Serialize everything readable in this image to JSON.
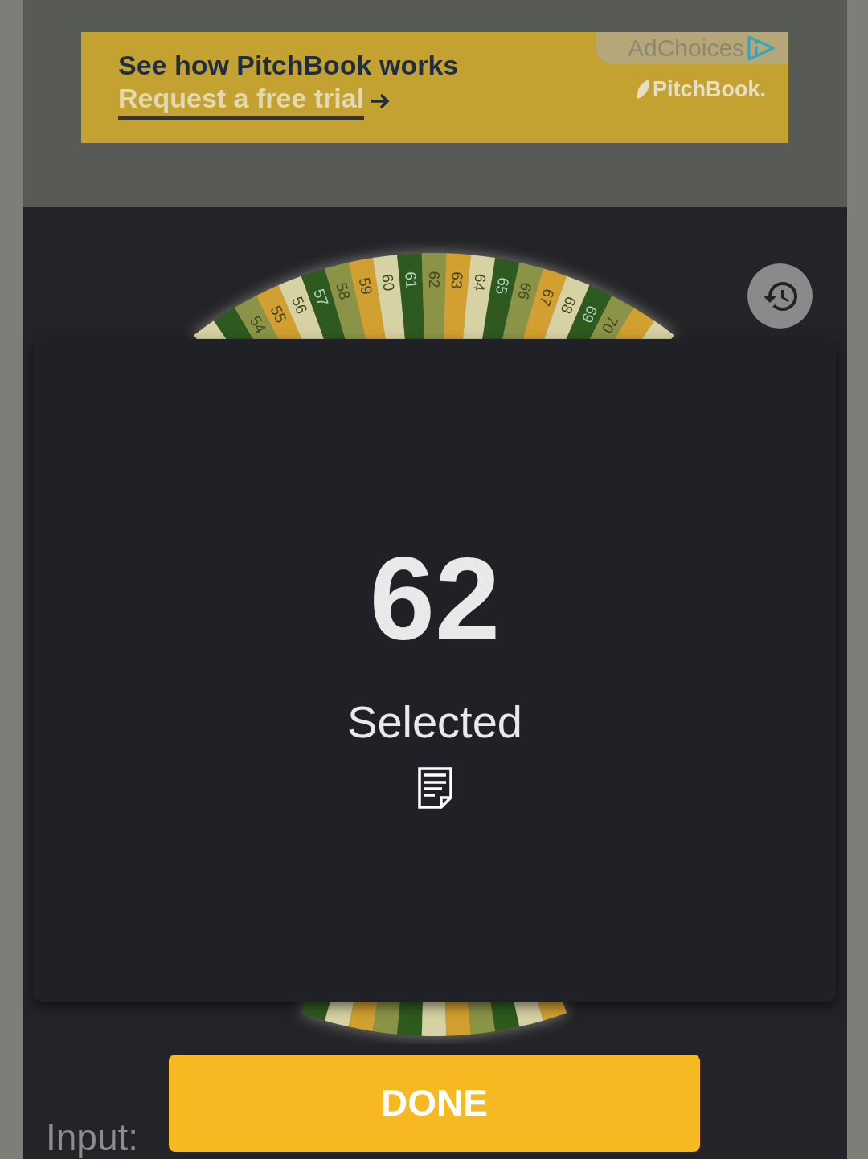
{
  "ad": {
    "headline": "See how PitchBook works",
    "link": "Request a free trial",
    "adchoices": "AdChoices",
    "brand": "PitchBook."
  },
  "wheel": {
    "top_segments": [
      {
        "color": "#d6d2a4"
      },
      {
        "color": "#2e5a1f"
      },
      {
        "label": "54",
        "color": "#8b9446"
      },
      {
        "label": "55",
        "color": "#d1a030"
      },
      {
        "label": "56",
        "color": "#d6d2a4"
      },
      {
        "label": "57",
        "color": "#2e5a1f"
      },
      {
        "label": "58",
        "color": "#8b9446"
      },
      {
        "label": "59",
        "color": "#d1a030"
      },
      {
        "label": "60",
        "color": "#d6d2a4"
      },
      {
        "label": "61",
        "color": "#2e5a1f"
      },
      {
        "label": "62",
        "color": "#8b9446"
      },
      {
        "label": "63",
        "color": "#d1a030"
      },
      {
        "label": "64",
        "color": "#d6d2a4"
      },
      {
        "label": "65",
        "color": "#2e5a1f"
      },
      {
        "label": "66",
        "color": "#8b9446"
      },
      {
        "label": "67",
        "color": "#d1a030"
      },
      {
        "label": "68",
        "color": "#d6d2a4"
      },
      {
        "label": "69",
        "color": "#2e5a1f"
      },
      {
        "label": "70",
        "color": "#8b9446"
      },
      {
        "color": "#d1a030"
      },
      {
        "color": "#d6d2a4"
      }
    ],
    "bottom_segments": [
      {
        "color": "#2e5a1f"
      },
      {
        "color": "#d6d2a4"
      },
      {
        "color": "#d1a030"
      },
      {
        "color": "#8b9446"
      },
      {
        "color": "#2e5a1f"
      },
      {
        "color": "#d6d2a4"
      },
      {
        "color": "#d1a030"
      },
      {
        "color": "#8b9446"
      },
      {
        "color": "#2e5a1f"
      },
      {
        "color": "#d6d2a4"
      },
      {
        "color": "#d1a030"
      }
    ]
  },
  "result": {
    "value": "62",
    "caption": "Selected"
  },
  "done_button": "DONE",
  "input_label": "Input:"
}
